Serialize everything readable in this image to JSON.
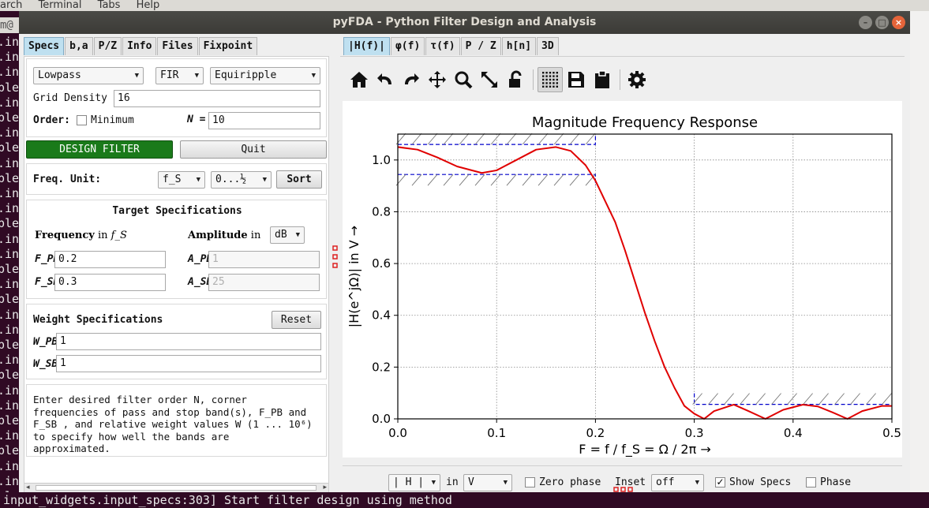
{
  "terminal": {
    "menu": [
      "arch",
      "Terminal",
      "Tabs",
      "Help"
    ],
    "tab_label": "m@",
    "left_lines": [
      ".in",
      ".in",
      ".in",
      "ple",
      ".in",
      "ple",
      ".in",
      "ple",
      ".in",
      "ple",
      ".in",
      ".in",
      "ple",
      ".in",
      ".in",
      "ple",
      ".in",
      "ple",
      ".in",
      ".in",
      "ple",
      ".in",
      "ple",
      ".in",
      ".in",
      "ple",
      ".in",
      "ple",
      ".in",
      ".in",
      "ple",
      ".in"
    ],
    "bottom_line": "input_widgets.input_specs:303] Start filter design using method"
  },
  "window": {
    "title": "pyFDA - Python Filter Design and Analysis",
    "controls": [
      "–",
      "□",
      "×"
    ]
  },
  "left": {
    "tabs": [
      "Specs",
      "b,a",
      "P/Z",
      "Info",
      "Files",
      "Fixpoint"
    ],
    "active_tab": "Specs",
    "response_type": "Lowpass",
    "filter_class": "FIR",
    "design_method": "Equiripple",
    "grid_density_label": "Grid Density",
    "grid_density_value": "16",
    "order_label": "Order:",
    "minimum_label": "Minimum",
    "n_label": "N =",
    "n_value": "10",
    "design_button": "DESIGN FILTER",
    "quit_button": "Quit",
    "freq_unit_label": "Freq. Unit:",
    "freq_unit": "f_S",
    "freq_range": "0...½",
    "sort_button": "Sort",
    "target_title": "Target Specifications",
    "frequency_label": "Frequency",
    "in_word": "in",
    "fs_symbol": "f_S",
    "amplitude_label": "Amplitude",
    "amp_unit": "dB",
    "fpb_label": "F_PB",
    "fpb_value": "0.2",
    "fsb_label": "F_SB",
    "fsb_value": "0.3",
    "apb_label": "A_PB",
    "apb_value": "1",
    "asb_label": "A_SB",
    "asb_value": "25",
    "weight_title": "Weight Specifications",
    "reset_button": "Reset",
    "wpb_label": "W_PB",
    "wpb_value": "1",
    "wsb_label": "W_SB",
    "wsb_value": "1",
    "info_line1": "Enter desired filter order N, corner",
    "info_line2": "frequencies of pass and stop band(s), F_PB  and",
    "info_line3": "F_SB , and relative weight values W (1 ... 10⁶)",
    "info_line4": "to specify how well the bands are",
    "info_line5": "approximated."
  },
  "right": {
    "tabs": [
      "|H(f)|",
      "φ(f)",
      "τ(f)",
      "P / Z",
      "h[n]",
      "3D"
    ],
    "active_tab": "|H(f)|",
    "toolbar_icons": [
      "home-icon",
      "undo-icon",
      "redo-icon",
      "pan-icon",
      "zoom-icon",
      "full-view-icon",
      "lock-icon",
      "grid-icon",
      "save-icon",
      "clipboard-icon",
      "settings-icon"
    ],
    "bottom": {
      "mag_select": "| H |",
      "in_label": "in",
      "unit_select": "V",
      "zero_phase_label": "Zero phase",
      "inset_label": "Inset",
      "inset_select": "off",
      "show_specs_label": "Show Specs",
      "phase_label": "Phase"
    }
  },
  "chart_data": {
    "type": "line",
    "title": "Magnitude Frequency Response",
    "xlabel": "F = f / f_S = Ω / 2π →",
    "ylabel": "|H(e^jΩ)| in V →",
    "xlim": [
      0.0,
      0.5
    ],
    "ylim": [
      0.0,
      1.1
    ],
    "xticks": [
      "0.0",
      "0.1",
      "0.2",
      "0.3",
      "0.4",
      "0.5"
    ],
    "yticks": [
      "0.0",
      "0.2",
      "0.4",
      "0.6",
      "0.8",
      "1.0"
    ],
    "grid": true,
    "series": [
      {
        "color": "#e00000",
        "x": [
          0.0,
          0.02,
          0.04,
          0.06,
          0.085,
          0.1,
          0.12,
          0.14,
          0.16,
          0.175,
          0.19,
          0.2,
          0.21,
          0.22,
          0.23,
          0.24,
          0.25,
          0.26,
          0.27,
          0.28,
          0.29,
          0.3,
          0.31,
          0.32,
          0.34,
          0.355,
          0.372,
          0.39,
          0.41,
          0.425,
          0.44,
          0.455,
          0.47,
          0.49,
          0.5
        ],
        "y": [
          1.05,
          1.04,
          1.01,
          0.975,
          0.95,
          0.96,
          1.0,
          1.04,
          1.05,
          1.035,
          0.98,
          0.92,
          0.84,
          0.76,
          0.65,
          0.53,
          0.41,
          0.3,
          0.2,
          0.12,
          0.05,
          0.02,
          0.0,
          0.03,
          0.055,
          0.03,
          0.0,
          0.035,
          0.055,
          0.048,
          0.025,
          0.0,
          0.03,
          0.05,
          0.05
        ]
      }
    ],
    "spec_lines": {
      "color": "#0000cc",
      "passband_upper": 1.06,
      "passband_lower": 0.944,
      "passband_edge": 0.2,
      "stopband_edge": 0.3,
      "stopband_level": 0.056
    }
  }
}
